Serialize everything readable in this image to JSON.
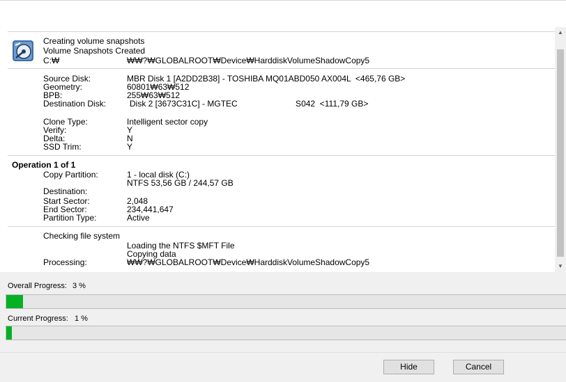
{
  "log": {
    "snapshot": {
      "line1": "Creating volume snapshots",
      "line2": "Volume Snapshots Created",
      "drive_label": "C:₩",
      "drive_value": "₩₩?₩GLOBALROOT₩Device₩HarddiskVolumeShadowCopy5"
    },
    "disk_info": {
      "source_label": "Source Disk:",
      "source_value": "MBR Disk 1 [A2DD2B38] - TOSHIBA MQ01ABD050 AX004L  <465,76 GB>",
      "geometry_label": "Geometry:",
      "geometry_value": "60801₩63₩512",
      "bpb_label": "BPB:",
      "bpb_value": "255₩63₩512",
      "dest_label": "Destination Disk:",
      "dest_value": "Disk 2 [3673C31C] - MGTEC                         S042  <111,79 GB>"
    },
    "clone": {
      "type_label": "Clone Type:",
      "type_value": "Intelligent sector copy",
      "verify_label": "Verify:",
      "verify_value": "Y",
      "delta_label": "Delta:",
      "delta_value": "N",
      "ssd_label": "SSD Trim:",
      "ssd_value": "Y"
    },
    "operation": {
      "title": "Operation 1 of 1",
      "copy_label": "Copy Partition:",
      "copy_value1": "1 - local disk (C:)",
      "copy_value2": "NTFS 53,56 GB / 244,57 GB",
      "dest_label": "Destination:",
      "start_label": "Start Sector:",
      "start_value": "2,048",
      "end_label": "End Sector:",
      "end_value": "234,441,647",
      "ptype_label": "Partition Type:",
      "ptype_value": "Active"
    },
    "check": {
      "line1": "Checking file system",
      "line2": "Loading the NTFS $MFT File",
      "line3": "Copying data",
      "processing_label": "Processing:",
      "processing_value": "₩₩?₩GLOBALROOT₩Device₩HarddiskVolumeShadowCopy5"
    }
  },
  "progress": {
    "overall_label": "Overall Progress:",
    "overall_text": "3 %",
    "overall_fraction": 0.03,
    "current_label": "Current Progress:",
    "current_text": "1 %",
    "current_fraction": 0.01
  },
  "buttons": {
    "hide": "Hide",
    "cancel": "Cancel"
  },
  "colors": {
    "progress_fill": "#06b025"
  }
}
